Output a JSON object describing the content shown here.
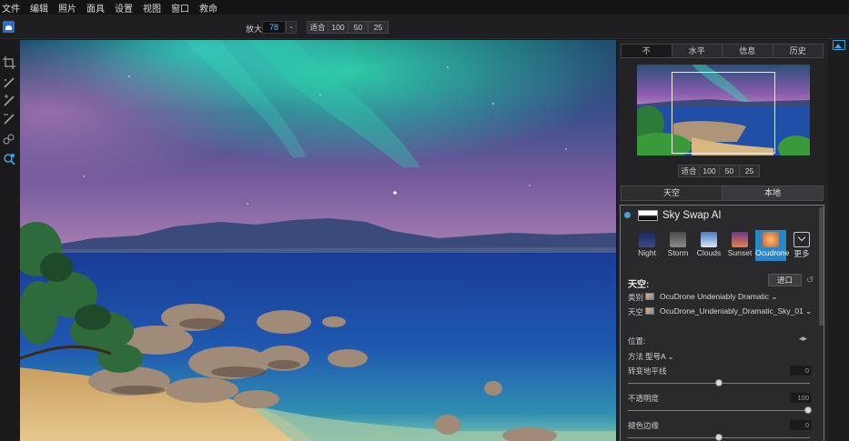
{
  "menu": [
    "文件",
    "编辑",
    "照片",
    "面具",
    "设置",
    "视图",
    "窗口",
    "救命"
  ],
  "toolbar": {
    "zoom_label": "放大",
    "zoom_value": "78",
    "zoom_drop": "⌄",
    "fit_buttons": [
      "适合",
      "100",
      "50",
      "25"
    ]
  },
  "colors": {
    "accent": "#2a86c8",
    "zoom_value": "#5ec1ff",
    "module_border": "#3a8fb0"
  },
  "tools": [
    "crop-icon",
    "brush-icon",
    "brush-plus-icon",
    "brush-minus-icon",
    "mask-icon",
    "zoom-icon"
  ],
  "panel": {
    "tabs": [
      "不",
      "水平",
      "信息",
      "历史"
    ],
    "fit_buttons": [
      "适合",
      "100",
      "50",
      "25"
    ],
    "sky_tabs": [
      "天空",
      "本地"
    ]
  },
  "module": {
    "title": "Sky Swap AI",
    "presets": [
      {
        "label": "Night",
        "color": "#2d3a6a"
      },
      {
        "label": "Storm",
        "color": "#6e6e6e"
      },
      {
        "label": "Clouds",
        "color": "#5a84c6"
      },
      {
        "label": "Sunset",
        "color": "#d07a4a"
      },
      {
        "label": "Ocudrone",
        "color": "#e88a3a"
      },
      {
        "label": "更多",
        "color": "transparent"
      }
    ],
    "sky_section": "天空:",
    "import_label": "进口",
    "category_label": "类别",
    "category_value": "OcuDrone Undeniably Dramatic ⌄",
    "sky_label": "天空",
    "sky_value": "OcuDrone_Undeniably_Dramatic_Sky_01 ⌄",
    "position_label": "位置:",
    "method_label": "方法",
    "method_value": "型号A ⌄",
    "horizon_label": "转变地平线",
    "horizon_value": "0",
    "opacity_label": "不透明度",
    "opacity_value": "100",
    "edge_label": "褪色边缘",
    "edge_value": "0"
  }
}
